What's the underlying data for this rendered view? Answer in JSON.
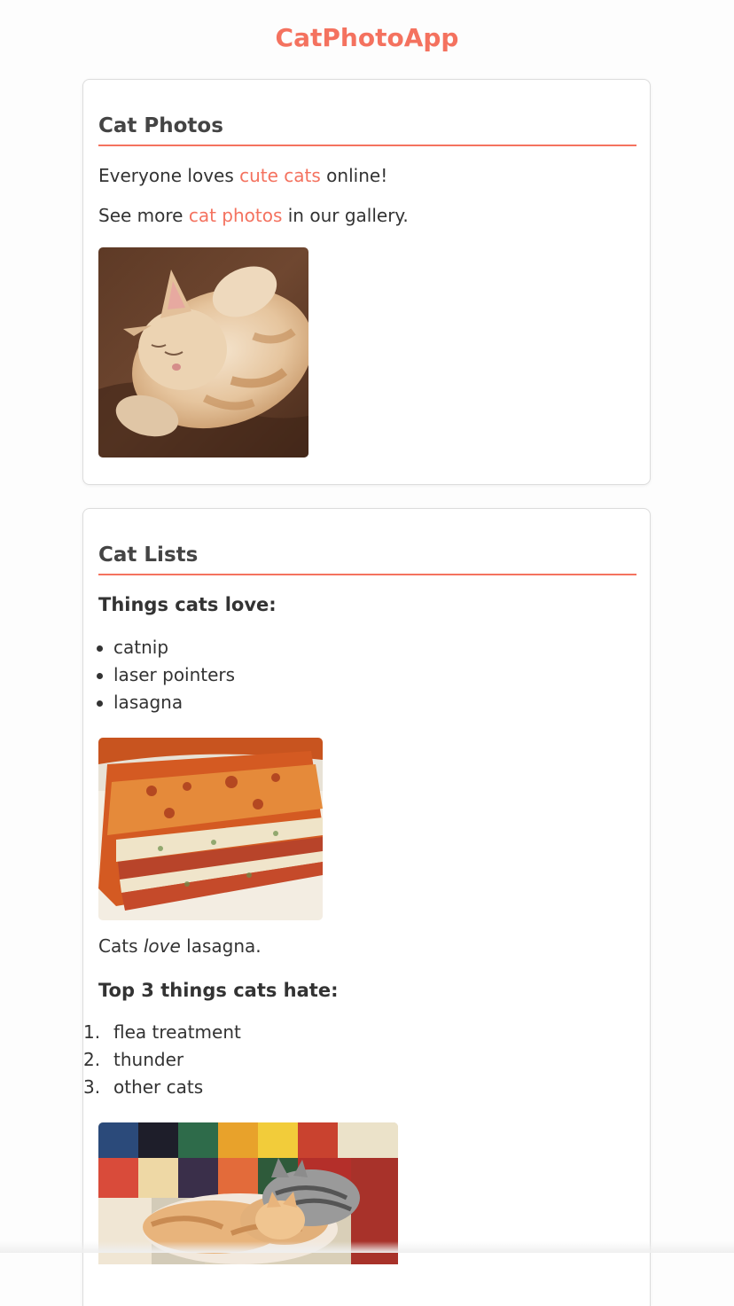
{
  "app": {
    "title": "CatPhotoApp"
  },
  "colors": {
    "accent": "#f4725f",
    "text": "#333333",
    "card_border": "#dcdcdc"
  },
  "cat_photos": {
    "heading": "Cat Photos",
    "para1": {
      "before": "Everyone loves ",
      "link": "cute cats",
      "after": " online!"
    },
    "para2": {
      "before": "See more ",
      "link": "cat photos",
      "after": " in our gallery."
    },
    "image": "sleeping-orange-cat-photo"
  },
  "cat_lists": {
    "heading": "Cat Lists",
    "love_heading": "Things cats love:",
    "love_items": [
      "catnip",
      "laser pointers",
      "lasagna"
    ],
    "lasagna_image": "lasagna-photo",
    "caption": {
      "before": "Cats ",
      "em": "love",
      "after": " lasagna."
    },
    "hate_heading": "Top 3 things cats hate:",
    "hate_items": [
      {
        "num": "1.",
        "label": "flea treatment"
      },
      {
        "num": "2.",
        "label": "thunder"
      },
      {
        "num": "3.",
        "label": "other cats"
      }
    ],
    "cats_image": "two-cats-on-blanket-photo"
  }
}
